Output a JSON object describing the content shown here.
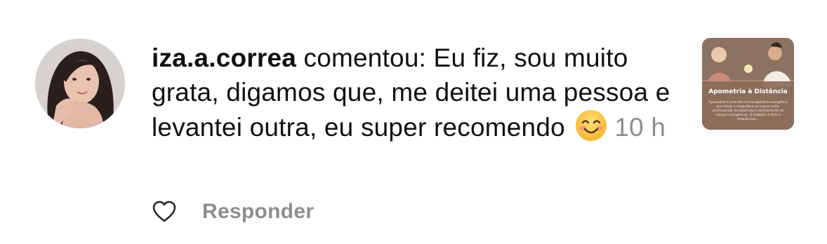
{
  "comment": {
    "username": "iza.a.correa",
    "text": " comentou: Eu fiz, sou muito grata, digamos que, me deitei uma pessoa e levantei outra, eu super recomendo ",
    "emoji": "smiling-face-with-smiling-eyes",
    "time": "10 h"
  },
  "post_thumbnail": {
    "title": "Apometria à Distância",
    "body": "Apometria é uma técnica terapêutica energética que limpa e reequilibra os corpos sutis, promovendo desobsessão e alinhamento de campos energéticos. O trabalho é feito a frequências..."
  },
  "actions": {
    "like_icon": "heart-outline-icon",
    "reply_label": "Responder"
  },
  "colors": {
    "text": "#111111",
    "muted": "#8e8e8e",
    "background": "#ffffff"
  }
}
